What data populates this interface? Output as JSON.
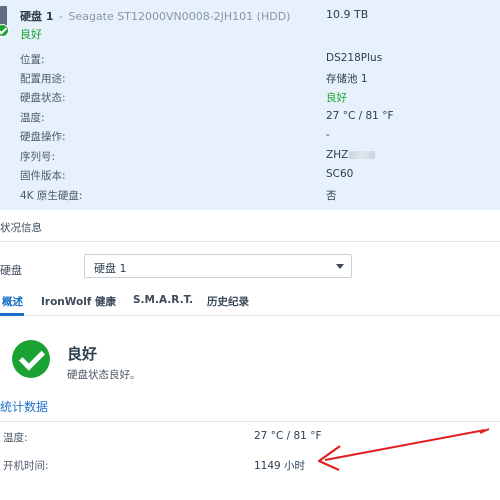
{
  "disk": {
    "name": "硬盘 1",
    "separator": "-",
    "model": "Seagate ST12000VN0008-2JH101 (HDD)",
    "size": "10.9 TB",
    "status": "良好",
    "properties": [
      {
        "key": "位置:",
        "value": "DS218Plus"
      },
      {
        "key": "配置用途:",
        "value": "存储池 1"
      },
      {
        "key": "硬盘状态:",
        "value": "良好"
      },
      {
        "key": "温度:",
        "value": "27 °C / 81 °F"
      },
      {
        "key": "硬盘操作:",
        "value": "-"
      },
      {
        "key": "序列号:",
        "value": "ZHZ"
      },
      {
        "key": "固件版本:",
        "value": "SC60"
      },
      {
        "key": "4K 原生硬盘:",
        "value": "否"
      }
    ]
  },
  "health": {
    "section_title": "状况信息",
    "disk_label": "硬盘",
    "disk_selected": "硬盘 1",
    "tabs": [
      {
        "label": "概述"
      },
      {
        "label": "IronWolf 健康"
      },
      {
        "label": "S.M.A.R.T."
      },
      {
        "label": "历史纪录"
      }
    ],
    "status_title": "良好",
    "status_desc": "硬盘状态良好。",
    "stats_title": "统计数据",
    "stats": [
      {
        "key": "温度:",
        "value": "27 °C / 81 °F"
      },
      {
        "key": "开机时间:",
        "value": "1149 小时"
      }
    ]
  },
  "colors": {
    "panel_bg": "#e6f1fb",
    "good_green": "#1aa332",
    "accent_blue": "#1a6fc9",
    "annotation_red": "#e02020"
  }
}
